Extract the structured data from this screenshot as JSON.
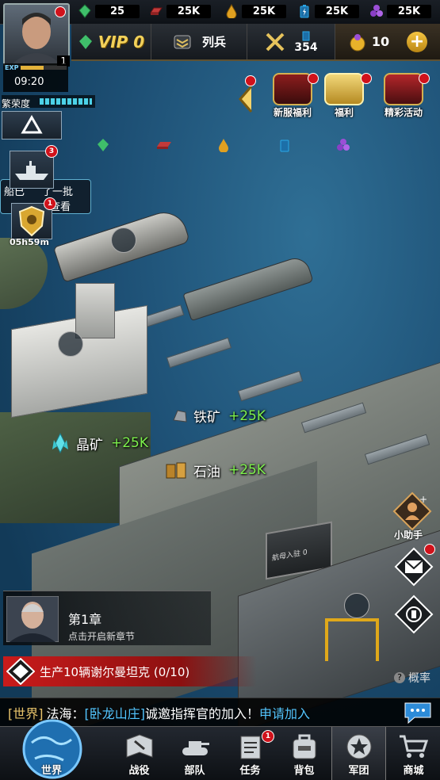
{
  "resources": [
    {
      "name": "crystal",
      "value": "25",
      "color": "#3fbf6a",
      "icon": "crystal-icon"
    },
    {
      "name": "iron",
      "value": "25K",
      "color": "#c23a3a",
      "icon": "iron-ingot-icon"
    },
    {
      "name": "oil",
      "value": "25K",
      "color": "#e0a020",
      "icon": "oil-drop-icon"
    },
    {
      "name": "battery",
      "value": "25K",
      "color": "#2aa8e8",
      "icon": "battery-icon"
    },
    {
      "name": "gems",
      "value": "25K",
      "color": "#9b4fd6",
      "icon": "gems-icon"
    }
  ],
  "header": {
    "vip_label": "VIP 0",
    "recruit_label": "列兵",
    "power_value": "354",
    "gold_value": "10"
  },
  "player": {
    "level": "1",
    "exp_label": "EXP",
    "time": "09:20",
    "prosperity_label": "繁荣度"
  },
  "left_panel": {
    "timer": "05h59m",
    "notice_text": "船已",
    "notice_text2": "了一批",
    "notice_view": "查看",
    "ship_badge": "3",
    "shield_badge": "1"
  },
  "events": [
    {
      "label": "新服福利"
    },
    {
      "label": "福利"
    },
    {
      "label": "精彩活动"
    }
  ],
  "yields": [
    {
      "name": "铁矿",
      "amount": "+25K"
    },
    {
      "name": "晶矿",
      "amount": "+25K"
    },
    {
      "name": "石油",
      "amount": "+25K"
    }
  ],
  "helper_label": "小助手",
  "chapter": {
    "title": "第1章",
    "subtitle": "点击开启新章节"
  },
  "task": {
    "text": "生产10辆谢尔曼坦克 (0/10)"
  },
  "probability_label": "概率",
  "chat": {
    "channel": "[世界]",
    "sender": "法海：",
    "guild": "[卧龙山庄]",
    "message": "诚邀指挥官的加入！",
    "link": "申请加入"
  },
  "nav": [
    {
      "label": "世界"
    },
    {
      "label": "战役"
    },
    {
      "label": "部队"
    },
    {
      "label": "任务",
      "badge": "1"
    },
    {
      "label": "背包"
    },
    {
      "label": "军团"
    },
    {
      "label": "商城"
    }
  ],
  "sign_label": "航母入驻 0"
}
